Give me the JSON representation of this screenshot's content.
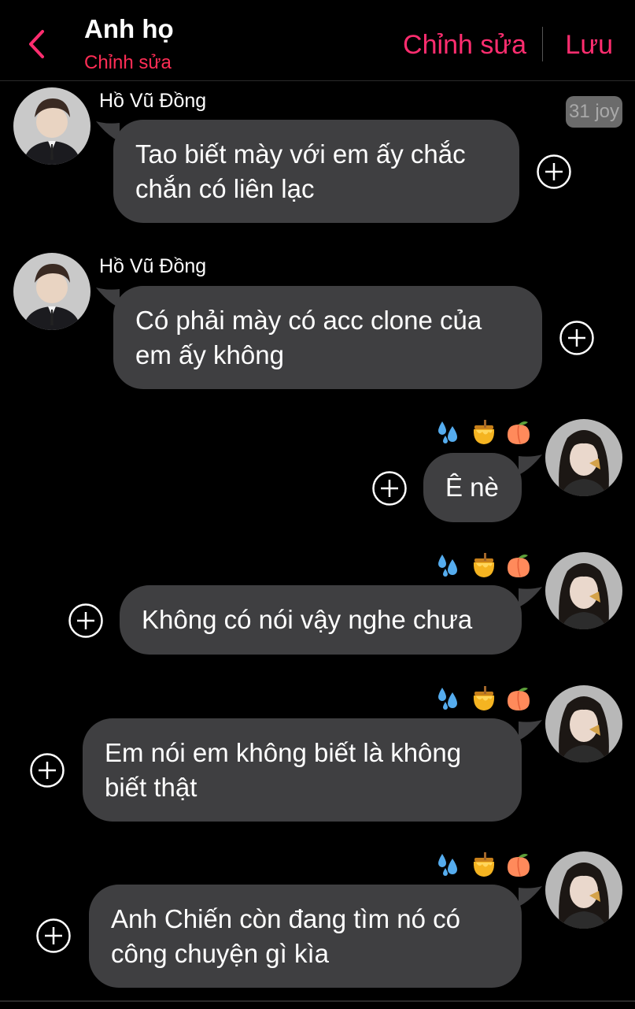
{
  "header": {
    "title": "Anh họ",
    "subtitle": "Chỉnh sửa",
    "edit_label": "Chỉnh sửa",
    "save_label": "Lưu",
    "accent": "#ff2d6f"
  },
  "time_badge": "31 joy",
  "messages": [
    {
      "sender": "Hồ Vũ Đồng",
      "text": "Tao biết mày với em ấy chắc chắn có liên lạc",
      "side": "left"
    },
    {
      "sender": "Hồ Vũ Đồng",
      "text": "Có phải mày có acc clone của em ấy không",
      "side": "left"
    },
    {
      "text": "Ê nè",
      "side": "right",
      "reactions": [
        "sweat-drops",
        "honey-pot",
        "peach"
      ]
    },
    {
      "text": "Không có nói vậy nghe chưa",
      "side": "right",
      "reactions": [
        "sweat-drops",
        "honey-pot",
        "peach"
      ]
    },
    {
      "text": "Em nói em không biết là không biết thật",
      "side": "right",
      "reactions": [
        "sweat-drops",
        "honey-pot",
        "peach"
      ]
    },
    {
      "text": "Anh Chiến còn đang tìm nó có công chuyện gì kìa",
      "side": "right",
      "reactions": [
        "sweat-drops",
        "honey-pot",
        "peach"
      ]
    }
  ],
  "icons": {
    "back": "chevron-left-icon",
    "add_reaction": "plus-circle-icon",
    "avatar_left": "avatar-male",
    "avatar_right": "avatar-female"
  }
}
